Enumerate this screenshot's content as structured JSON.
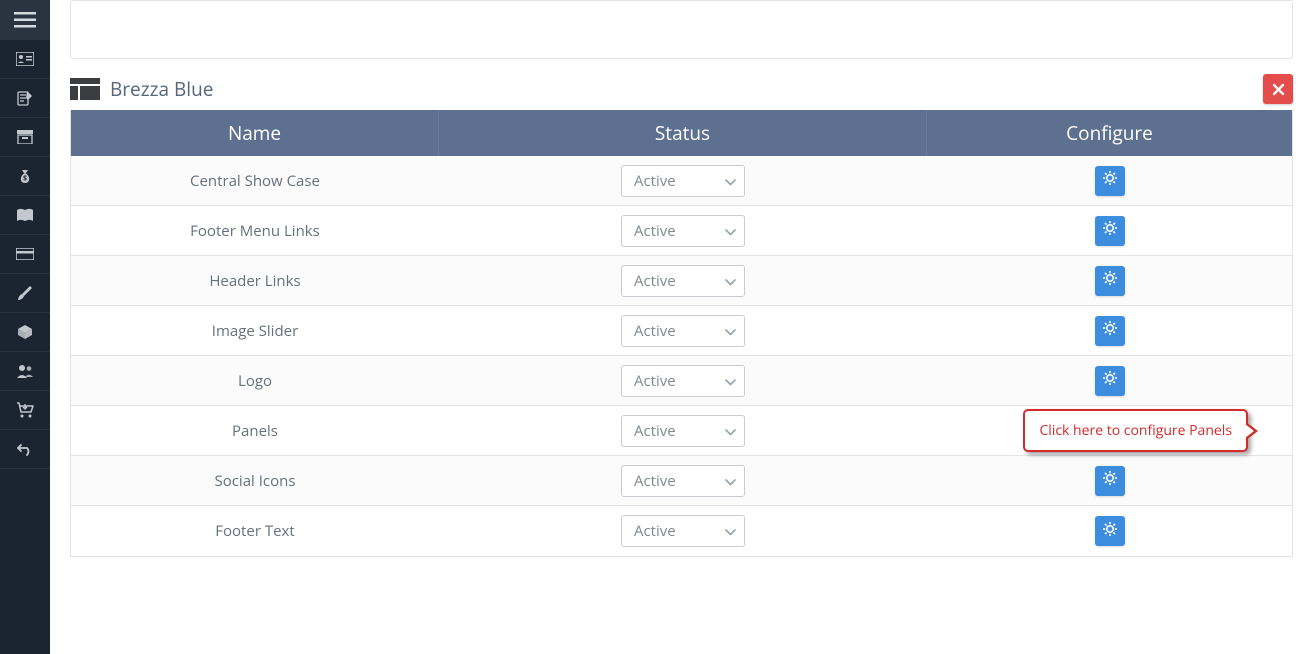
{
  "sidebar": {
    "items": [
      {
        "name": "hamburger-menu",
        "icon": "hamburger"
      },
      {
        "name": "id-card",
        "icon": "id-card"
      },
      {
        "name": "edit-doc",
        "icon": "edit-doc"
      },
      {
        "name": "archive",
        "icon": "archive"
      },
      {
        "name": "money-bag",
        "icon": "money-bag"
      },
      {
        "name": "book",
        "icon": "book"
      },
      {
        "name": "card",
        "icon": "card"
      },
      {
        "name": "brush",
        "icon": "brush"
      },
      {
        "name": "box-3d",
        "icon": "box-3d"
      },
      {
        "name": "users",
        "icon": "users"
      },
      {
        "name": "cart",
        "icon": "cart"
      },
      {
        "name": "undo",
        "icon": "undo"
      }
    ]
  },
  "panel": {
    "title": "Brezza Blue"
  },
  "table": {
    "headers": {
      "name": "Name",
      "status": "Status",
      "configure": "Configure"
    },
    "status_value": "Active",
    "rows": [
      {
        "name": "Central Show Case"
      },
      {
        "name": "Footer Menu Links"
      },
      {
        "name": "Header Links"
      },
      {
        "name": "Image Slider"
      },
      {
        "name": "Logo"
      },
      {
        "name": "Panels"
      },
      {
        "name": "Social Icons"
      },
      {
        "name": "Footer Text"
      }
    ]
  },
  "callout": {
    "text": "Click here to configure Panels",
    "target_row_index": 5
  }
}
